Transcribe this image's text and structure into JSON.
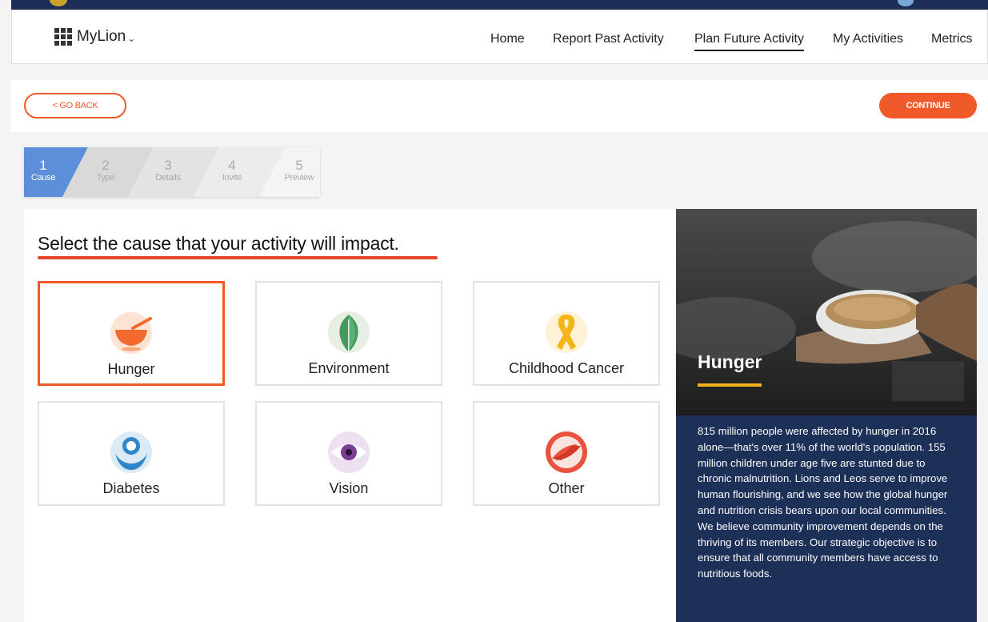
{
  "nav": {
    "brand": "MyLion",
    "links": [
      "Home",
      "Report Past Activity",
      "Plan Future Activity",
      "My Activities",
      "Metrics"
    ],
    "active": "Plan Future Activity"
  },
  "actions": {
    "back_label": "< GO BACK",
    "continue_label": "CONTINUE",
    "accent_color": "#f05a2b"
  },
  "steps": [
    {
      "num": "1",
      "label": "Cause",
      "active": true
    },
    {
      "num": "2",
      "label": "Type"
    },
    {
      "num": "3",
      "label": "Details"
    },
    {
      "num": "4",
      "label": "Invite"
    },
    {
      "num": "5",
      "label": "Preview"
    }
  ],
  "main": {
    "heading": "Select the cause that your activity will impact.",
    "causes": [
      {
        "label": "Hunger",
        "icon": "hunger-bowl-icon",
        "selected": true
      },
      {
        "label": "Environment",
        "icon": "leaf-icon"
      },
      {
        "label": "Childhood Cancer",
        "icon": "ribbon-icon"
      },
      {
        "label": "Diabetes",
        "icon": "diabetes-icon"
      },
      {
        "label": "Vision",
        "icon": "eye-icon"
      },
      {
        "label": "Other",
        "icon": "helping-hands-icon"
      }
    ]
  },
  "side": {
    "title": "Hunger",
    "description": "815 million people were affected by hunger in 2016 alone—that's over 11% of the world's population. 155 million children under age five are stunted due to chronic malnutrition. Lions and Leos serve to improve human flourishing, and we see how the global hunger and nutrition crisis bears upon our local communities. We believe community improvement depends on the thriving of its members. Our strategic objective is to ensure that all community members have access to nutritious foods."
  }
}
